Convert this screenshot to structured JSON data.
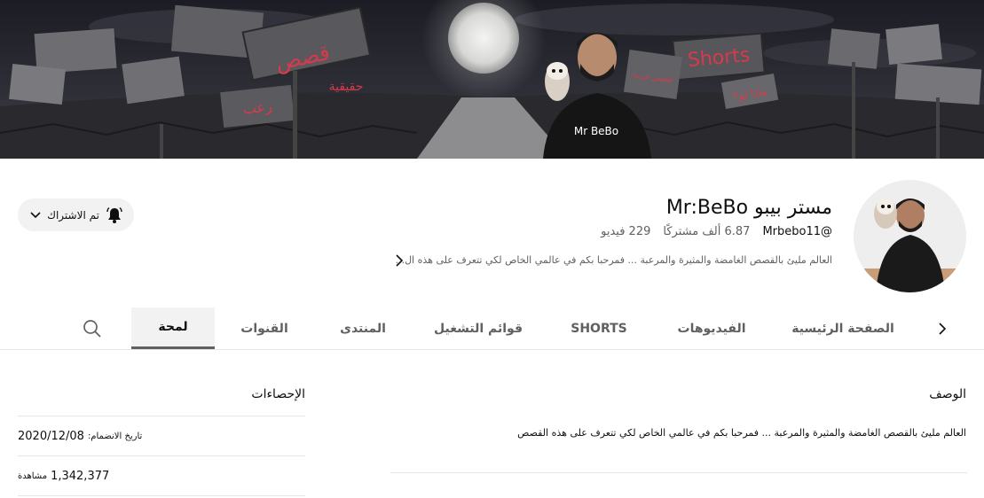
{
  "header": {
    "name": "مستر بيبو Mr:BeBo",
    "handle": "@Mrbebo11",
    "subscribers": "6.87 ألف مشتركًا",
    "videos": "229 فيديو",
    "description": "العالم مليئ بالقصص الغامضة والمثيرة والمرعبة ... فمرحبا بكم في عالمي الخاص لكي تتعرف على هذه ال...",
    "subscribe_label": "تم الاشتراك"
  },
  "banner": {
    "signs": [
      "قصص",
      "حقيقية",
      "رعب",
      "Shorts",
      "ماذا لو؟",
      "قصص غريبة",
      "Mr BeBo"
    ]
  },
  "tabs": [
    {
      "label": "الصفحة الرئيسية"
    },
    {
      "label": "الفيديوهات"
    },
    {
      "label": "SHORTS"
    },
    {
      "label": "قوائم التشغيل"
    },
    {
      "label": "المنتدى"
    },
    {
      "label": "القنوات"
    },
    {
      "label": "لمحة"
    }
  ],
  "about": {
    "description_title": "الوصف",
    "description_text": "العالم مليئ بالقصص الغامضة والمثيرة والمرعبة ... فمرحبا بكم في عالمي الخاص لكي تتعرف على هذه القصص",
    "stats_title": "الإحصاءات",
    "joined_label": "تاريخ الانضمام:",
    "joined_date": "2020/12/08",
    "views_number": "1,342,377",
    "views_label": "مشاهدة"
  },
  "icons": {
    "bell": "bell-icon",
    "chevron_down": "chevron-down-icon",
    "chevron_right": "chevron-right-icon",
    "chevron_left": "chevron-left-icon",
    "search": "search-icon"
  },
  "colors": {
    "text": "#0f0f0f",
    "secondary_text": "#606060",
    "chip_bg": "#f2f2f2",
    "divider": "#e5e5e5",
    "banner_sign_text": "#d9394b"
  }
}
